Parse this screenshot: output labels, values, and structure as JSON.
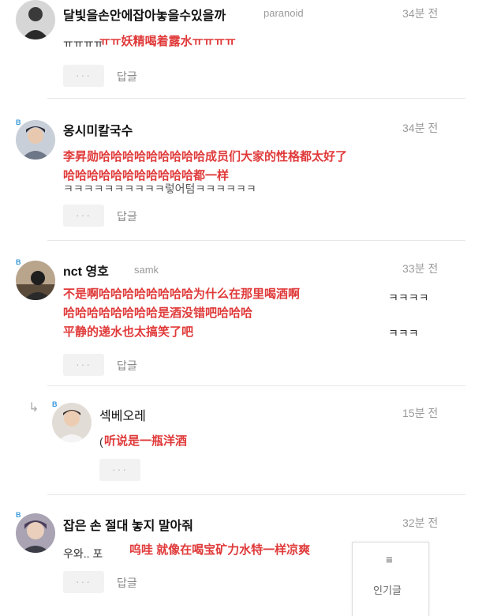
{
  "comments": [
    {
      "name": "달빛을손안에잡아놓을수있을까",
      "sub": "paranoid",
      "time": "34분 전",
      "body": "ㅠㅠㅠㅠ",
      "overlay": [
        "ㅠㅠ妖精喝着露水ㅠㅠㅠㅠ"
      ],
      "more": "···",
      "reply": "답글"
    },
    {
      "badge": "B",
      "name": "옹시미칼국수",
      "time": "34분 전",
      "body": "ㅋㅋㅋㅋㅋㅋㅋㅋㅋㅋ렇어텀ㅋㅋㅋㅋㅋㅋ",
      "overlay": [
        "李昇勋哈哈哈哈哈哈哈哈哈成员们大家的性格都太好了",
        "哈哈哈哈哈哈哈哈哈哈哈都一样"
      ],
      "more": "···",
      "reply": "답글"
    },
    {
      "badge": "B",
      "name": "nct 영호",
      "sub": "samk",
      "time": "33분 전",
      "body": "ㅋㅋㅋㅋ",
      "body2": "ㅋㅋㅋ",
      "overlay": [
        "不是啊哈哈哈哈哈哈哈哈为什么在那里喝酒啊",
        "哈哈哈哈哈哈哈哈是酒没错吧哈哈哈",
        "平静的递水也太搞笑了吧"
      ],
      "more": "···",
      "reply": "답글"
    },
    {
      "badge": "B",
      "name": "섹베오레",
      "time": "15분 전",
      "body": "(",
      "overlay": [
        "听说是一瓶洋酒"
      ],
      "more": "···"
    },
    {
      "badge": "B",
      "name": "잡은 손 절대 놓지 말아줘",
      "time": "32분 전",
      "body": "우와.. 포",
      "overlay": [
        "呜哇 就像在喝宝矿力水特一样凉爽"
      ],
      "more": "···",
      "reply": "답글"
    }
  ],
  "float_panel": {
    "icon": "≡",
    "label": "인기글"
  }
}
